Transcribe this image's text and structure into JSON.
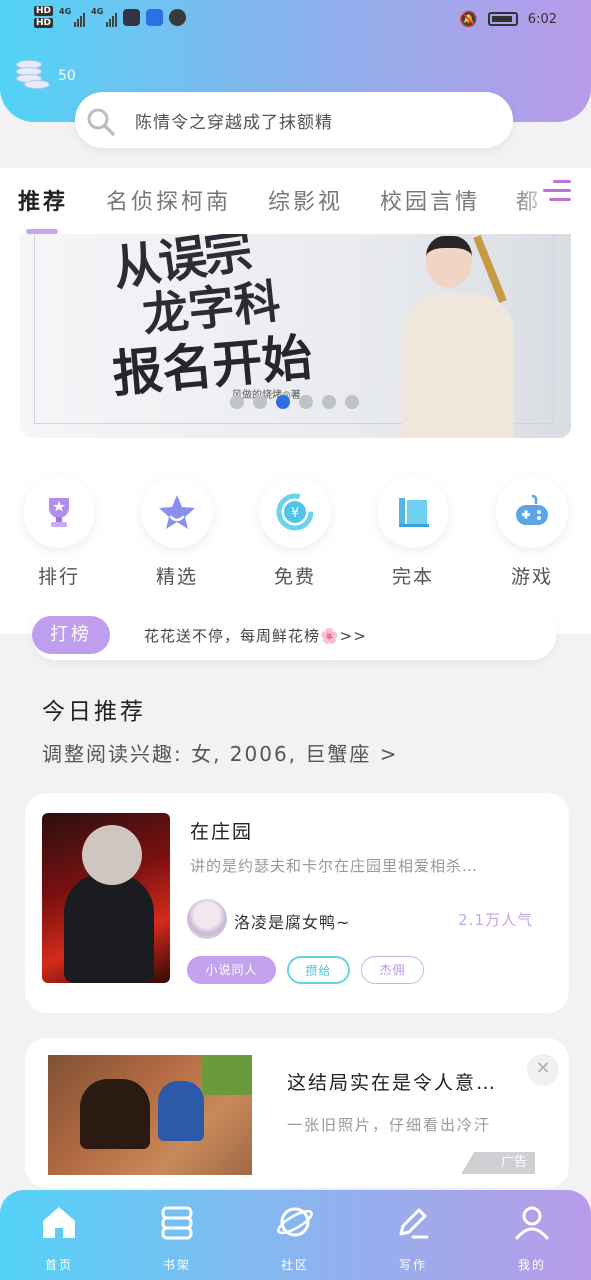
{
  "status_bar": {
    "hd1": "HD",
    "hd2": "HD",
    "net1": "4G",
    "net2": "4G",
    "time": "6:02"
  },
  "header": {
    "coins_count": "50",
    "search_placeholder": "陈情令之穿越成了抹额精"
  },
  "tabs": [
    {
      "label": "推荐",
      "active": true
    },
    {
      "label": "名侦探柯南"
    },
    {
      "label": "综影视"
    },
    {
      "label": "校园言情"
    },
    {
      "label": "都"
    }
  ],
  "banner": {
    "title_line1": "从误宗",
    "title_line2": "龙字科",
    "title_line3": "报名开始",
    "author": "风做的烧烤◎著",
    "dots": 6,
    "active_dot": 2
  },
  "quick_entries": [
    {
      "label": "排行",
      "icon": "trophy-icon"
    },
    {
      "label": "精选",
      "icon": "star-icon"
    },
    {
      "label": "免费",
      "icon": "yuan-icon"
    },
    {
      "label": "完本",
      "icon": "book-icon"
    },
    {
      "label": "游戏",
      "icon": "gamepad-icon"
    }
  ],
  "ranking": {
    "tag": "打榜",
    "text": "花花送不停，每周鲜花榜🌸>>"
  },
  "today": {
    "title": "今日推荐",
    "subtitle": "调整阅读兴趣: 女, 2006, 巨蟹座 >"
  },
  "book": {
    "title": "在庄园",
    "description": "讲的是约瑟夫和卡尔在庄园里相爱相杀…",
    "author": "洛凌是腐女鸭~",
    "popularity": "2.1万人气",
    "tags": [
      "小说同人",
      "攒给",
      "杰佣"
    ]
  },
  "ad": {
    "title": "这结局实在是令人意…",
    "description": "一张旧照片，仔细看出冷汗",
    "badge": "广告"
  },
  "bottom_nav": [
    {
      "label": "首页",
      "icon": "home-icon"
    },
    {
      "label": "书架",
      "icon": "bookshelf-icon"
    },
    {
      "label": "社区",
      "icon": "planet-icon"
    },
    {
      "label": "写作",
      "icon": "pen-icon"
    },
    {
      "label": "我的",
      "icon": "user-icon"
    }
  ],
  "colors": {
    "gradient_start": "#52d3f6",
    "gradient_end": "#b99ae9",
    "accent_purple": "#c3a2ee",
    "accent_cyan": "#66d5e3",
    "active_dot": "#2f6fe4"
  }
}
